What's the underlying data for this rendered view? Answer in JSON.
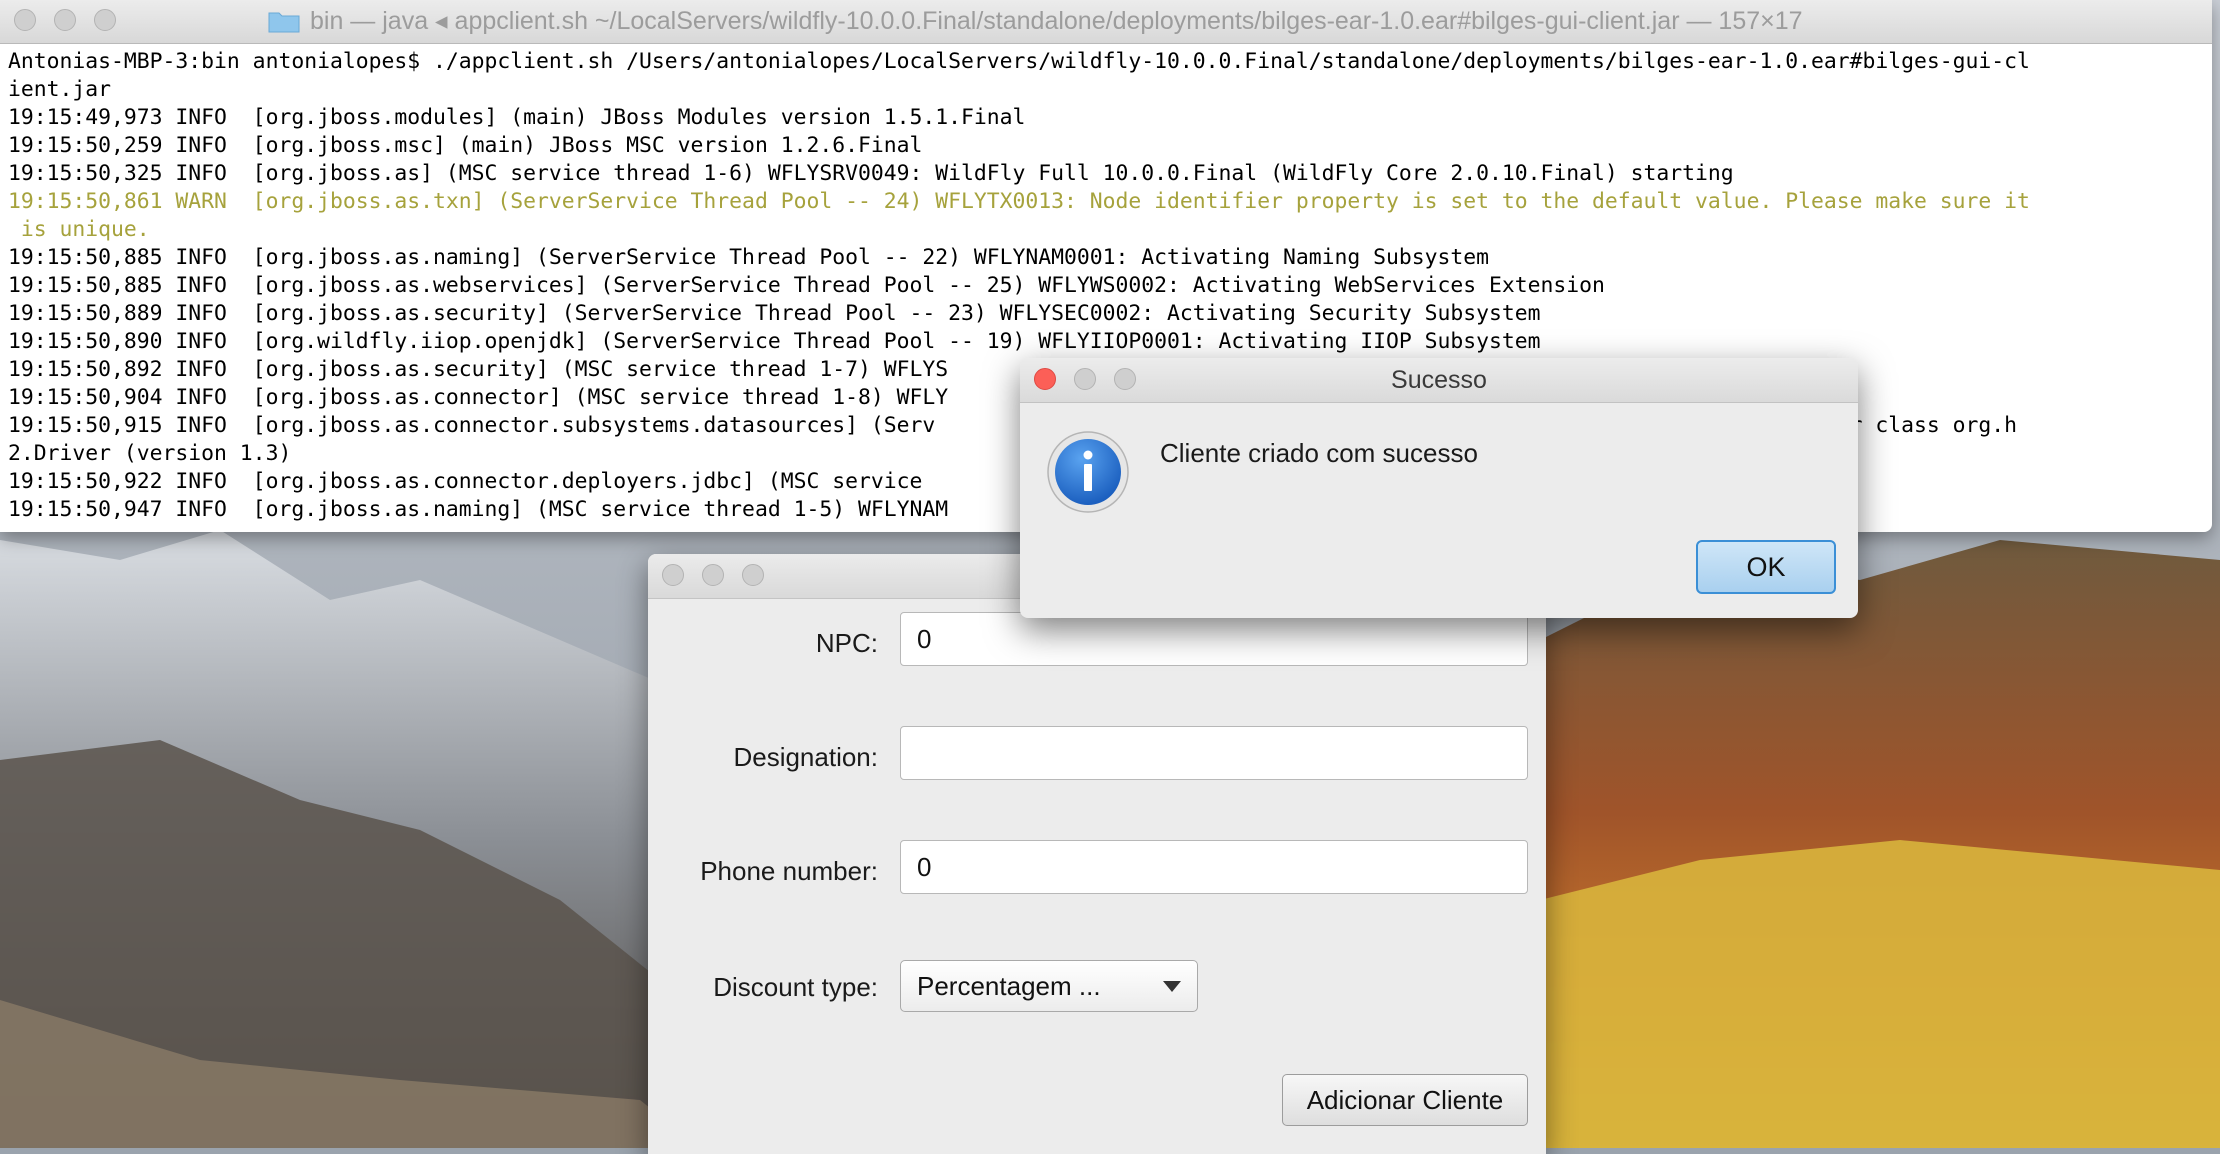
{
  "terminal": {
    "title": "bin — java ◂ appclient.sh ~/LocalServers/wildfly-10.0.0.Final/standalone/deployments/bilges-ear-1.0.ear#bilges-gui-client.jar — 157×17",
    "lines": [
      "Antonias-MBP-3:bin antonialopes$ ./appclient.sh /Users/antonialopes/LocalServers/wildfly-10.0.0.Final/standalone/deployments/bilges-ear-1.0.ear#bilges-gui-cl",
      "ient.jar",
      "19:15:49,973 INFO  [org.jboss.modules] (main) JBoss Modules version 1.5.1.Final",
      "19:15:50,259 INFO  [org.jboss.msc] (main) JBoss MSC version 1.2.6.Final",
      "19:15:50,325 INFO  [org.jboss.as] (MSC service thread 1-6) WFLYSRV0049: WildFly Full 10.0.0.Final (WildFly Core 2.0.10.Final) starting",
      "19:15:50,861 WARN  [org.jboss.as.txn] (ServerService Thread Pool -- 24) WFLYTX0013: Node identifier property is set to the default value. Please make sure it",
      " is unique.",
      "19:15:50,885 INFO  [org.jboss.as.naming] (ServerService Thread Pool -- 22) WFLYNAM0001: Activating Naming Subsystem",
      "19:15:50,885 INFO  [org.jboss.as.webservices] (ServerService Thread Pool -- 25) WFLYWS0002: Activating WebServices Extension",
      "19:15:50,889 INFO  [org.jboss.as.security] (ServerService Thread Pool -- 23) WFLYSEC0002: Activating Security Subsystem",
      "19:15:50,890 INFO  [org.wildfly.iiop.openjdk] (ServerService Thread Pool -- 19) WFLYIIOP0001: Activating IIOP Subsystem",
      "19:15:50,892 INFO  [org.jboss.as.security] (MSC service thread 1-7) WFLYS",
      "19:15:50,904 INFO  [org.jboss.as.connector] (MSC service thread 1-8) WFLY                                                           Final)",
      "19:15:50,915 INFO  [org.jboss.as.connector.subsystems.datasources] (Serv                                                           pliant driver class org.h",
      "2.Driver (version 1.3)",
      "19:15:50,922 INFO  [org.jboss.as.connector.deployers.jdbc] (MSC service                                                            name = h2",
      "19:15:50,947 INFO  [org.jboss.as.naming] (MSC service thread 1-5) WFLYNAM"
    ],
    "warn_lines": [
      5,
      6
    ],
    "warn_color": "#a6a23c"
  },
  "form": {
    "fields": [
      {
        "label": "NPC:",
        "value": "0"
      },
      {
        "label": "Designation:",
        "value": ""
      },
      {
        "label": "Phone number:",
        "value": "0"
      }
    ],
    "discount_label": "Discount type:",
    "discount_selected": "Percentagem ...",
    "add_button": "Adicionar Cliente"
  },
  "dialog": {
    "title": "Sucesso",
    "message": "Cliente criado com sucesso",
    "ok_button": "OK",
    "icon": "info-icon",
    "accent": "#3b8fd6"
  }
}
